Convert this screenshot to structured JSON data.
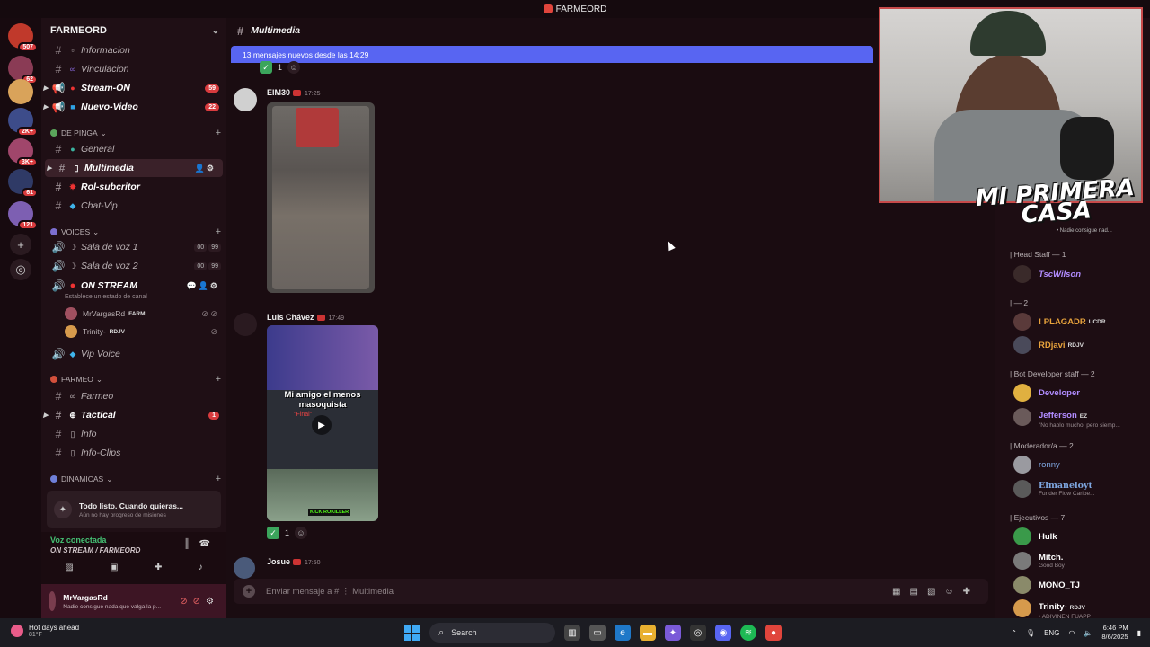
{
  "window": {
    "title": "FARMEORD"
  },
  "rail": {
    "badges": [
      "507",
      "62",
      "2K+",
      "3K+",
      "61",
      "121"
    ]
  },
  "sidebar": {
    "server_name": "FARMEORD",
    "channels_top": [
      {
        "label": "Informacion"
      },
      {
        "label": "Vinculacion"
      },
      {
        "label": "Stream-ON",
        "badge": "59"
      },
      {
        "label": "Nuevo-Video",
        "badge": "22"
      }
    ],
    "cat_de_pinga": "DE PINGA",
    "channels_pinga": [
      {
        "label": "General"
      },
      {
        "label": "Multimedia"
      },
      {
        "label": "Rol-subcritor"
      },
      {
        "label": "Chat-Vip"
      }
    ],
    "cat_voices": "VOICES",
    "voice_channels": [
      {
        "label": "Sala de voz 1",
        "c1": "00",
        "c2": "99"
      },
      {
        "label": "Sala de voz 2",
        "c1": "00",
        "c2": "99"
      },
      {
        "label": "ON STREAM"
      }
    ],
    "on_stream_status": "Establece un estado de canal",
    "voice_users": [
      {
        "name": "MrVargasRd",
        "tag": "FARM"
      },
      {
        "name": "Trinity-",
        "tag": "RDJV"
      }
    ],
    "vip_voice": "Vip Voice",
    "cat_farmeo": "FARMEO",
    "channels_farmeo": [
      {
        "label": "Farmeo"
      },
      {
        "label": "Tactical",
        "badge": "1"
      },
      {
        "label": "Info"
      },
      {
        "label": "Info-Clips"
      }
    ],
    "cat_dinamicas": "DINAMICAS",
    "quest_title": "Todo listo. Cuando quieras...",
    "quest_sub": "Aún no hay progreso de misiones",
    "voice_connected": "Voz conectada",
    "voice_channel": "ON STREAM / FARMEORD",
    "user_name": "MrVargasRd",
    "user_status": "Nadie consigue nada que valga la p..."
  },
  "main": {
    "channel_title": "Multimedia",
    "new_messages": "13 mensajes nuevos desde las 14:29",
    "top_reaction_count": "1",
    "messages": [
      {
        "author": "ElM30",
        "time": "17:25"
      },
      {
        "author": "Luis Chávez",
        "time": "17:49",
        "video_caption": "Mi amigo el menos masoquista",
        "video_sub": "\"Final\"",
        "kick_tag": "KICK ROKILLER",
        "reaction_count": "1"
      },
      {
        "author": "Josue",
        "time": "17:50"
      }
    ],
    "composer_placeholder": "Enviar mensaje a # ⋮ Multimedia"
  },
  "webcam": {
    "overlay": "MI PRIMERA CASA",
    "overlay_sub": "• Nadie consigue nad..."
  },
  "members": {
    "groups": [
      {
        "label": "| Head Staff — 1"
      },
      {
        "label": "| — 2"
      },
      {
        "label": "| Bot Developer staff — 2"
      },
      {
        "label": "| Moderador/a — 2"
      },
      {
        "label": "| Ejecutivos — 7"
      }
    ],
    "list": [
      {
        "name": "TscWilson",
        "color": "#b18cff"
      },
      {
        "name": "! PLAGADR",
        "tag": "UCDR",
        "color": "#e8a33c"
      },
      {
        "name": "RDjavi",
        "tag": "RDJV",
        "color": "#e8a33c"
      },
      {
        "name": "Developer",
        "color": "#b18cff"
      },
      {
        "name": "Jefferson",
        "tag": "EZ",
        "sub": "\"No hablo mucho, pero siemp...",
        "color": "#b18cff"
      },
      {
        "name": "ronny",
        "color": "#7ea6e0"
      },
      {
        "name": "Elmaneloyt",
        "sub": "Funder Flow Caribe...",
        "color": "#7ea6e0"
      },
      {
        "name": "Hulk",
        "color": "#ffffff"
      },
      {
        "name": "Mitch.",
        "sub": "Good Boy",
        "color": "#ffffff"
      },
      {
        "name": "MONO_TJ",
        "color": "#ffffff"
      },
      {
        "name": "Trinity-",
        "tag": "RDJV",
        "sub": "• ADIVINEN FUAPP",
        "color": "#ffffff"
      }
    ]
  },
  "taskbar": {
    "weather_title": "Hot days ahead",
    "weather_temp": "81°F",
    "search": "Search",
    "lang": "ENG",
    "time": "6:46 PM",
    "date": "8/6/2025"
  }
}
